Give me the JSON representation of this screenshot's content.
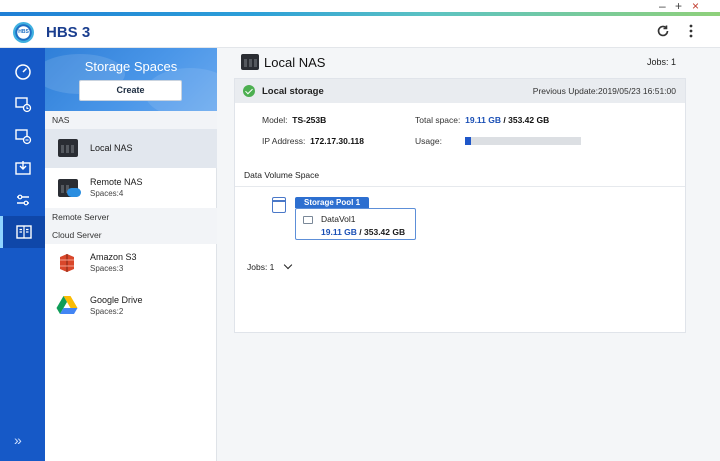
{
  "window": {
    "controls": {
      "minimize": "–",
      "maximize": "+",
      "close": "×"
    }
  },
  "header": {
    "logo_text": "HBS",
    "title": "HBS 3",
    "refresh_icon": "refresh-icon",
    "more_icon": "more-vertical-icon"
  },
  "rail": {
    "items": [
      {
        "icon": "dashboard-icon",
        "active": false
      },
      {
        "icon": "backup-icon",
        "active": false
      },
      {
        "icon": "sync-icon",
        "active": false
      },
      {
        "icon": "restore-icon",
        "active": false
      },
      {
        "icon": "services-icon",
        "active": false
      },
      {
        "icon": "storage-spaces-icon",
        "active": true
      }
    ],
    "expand": "»"
  },
  "sidebar": {
    "title": "Storage Spaces",
    "create_label": "Create",
    "sections": {
      "nas": "NAS",
      "remote_server": "Remote Server",
      "cloud_server": "Cloud Server"
    },
    "items": [
      {
        "label": "Local NAS",
        "sub": ""
      },
      {
        "label": "Remote NAS",
        "sub": "Spaces:4"
      },
      {
        "label": "Amazon S3",
        "sub": "Spaces:3"
      },
      {
        "label": "Google Drive",
        "sub": "Spaces:2"
      }
    ]
  },
  "main": {
    "title": "Local NAS",
    "jobs": "Jobs: 1",
    "card": {
      "title": "Local storage",
      "previous_update": "Previous Update:2019/05/23 16:51:00",
      "model_label": "Model:",
      "model_value": "TS-253B",
      "ip_label": "IP Address:",
      "ip_value": "172.17.30.118",
      "total_label": "Total space:",
      "total_used": "19.11 GB",
      "total_sep": " / ",
      "total_capacity": "353.42 GB",
      "usage_label": "Usage:",
      "usage_fraction": 0.054,
      "data_volume_space": "Data Volume Space",
      "pool_name": "Storage Pool 1",
      "volume_name": "DataVol1",
      "volume_used": "19.11 GB",
      "volume_sep": " / ",
      "volume_capacity": "353.42 GB",
      "jobs_label": "Jobs: 1"
    }
  },
  "colors": {
    "rail_bg": "#1659c7",
    "accent_blue": "#1a4fb5",
    "ok_green": "#4caf50",
    "usage_fill": "#1f57c9"
  }
}
